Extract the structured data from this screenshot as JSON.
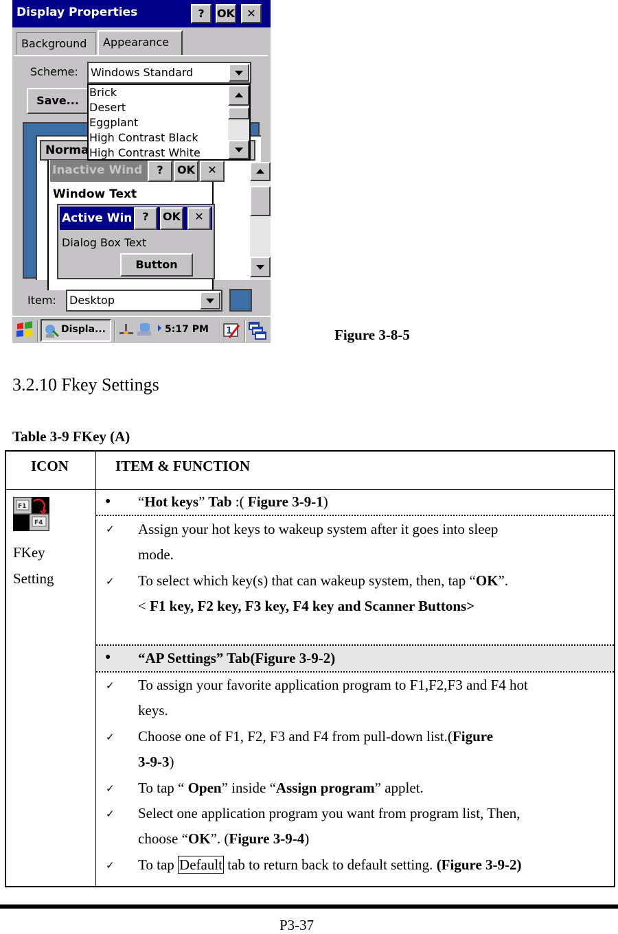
{
  "screenshot": {
    "window_title": "Display Properties",
    "title_buttons": {
      "help": "?",
      "ok": "OK",
      "close": "✕"
    },
    "tabs": [
      {
        "label": "Background",
        "active": false
      },
      {
        "label": "Appearance",
        "active": true
      }
    ],
    "scheme_label": "Scheme:",
    "scheme_value": "Windows Standard",
    "scheme_options": [
      "Brick",
      "Desert",
      "Eggplant",
      "High Contrast Black",
      "High Contrast White"
    ],
    "save_button": "Save...",
    "preview": {
      "normal_tab": "Normal",
      "inactive_title": "Inactive Wind",
      "window_text": "Window Text",
      "active_title": "Active Win",
      "dialog_text": "Dialog Box Text",
      "button_label": "Button",
      "btn_help": "?",
      "btn_ok": "OK",
      "btn_close": "✕"
    },
    "item_label": "Item:",
    "item_value": "Desktop",
    "item_color": "#3a6ea5",
    "taskbar": {
      "start_icon": "windows-flag-icon",
      "task_button": "Displa...",
      "time": "5:17 PM"
    },
    "colors": {
      "titlebar": "#00008b",
      "face": "#c6c3c6",
      "desktop": "#3a6ea5",
      "inactive": "#808080"
    }
  },
  "figure_caption": "Figure 3-8-5",
  "section_title": "3.2.10 Fkey Settings",
  "table_caption": "Table 3-9 FKey (A)",
  "table": {
    "headers": {
      "icon": "ICON",
      "item": "ITEM & FUNCTION"
    },
    "icon_label_line1": "FKey",
    "icon_label_line2": "Setting",
    "hotkeys_heading": {
      "q1": "“",
      "b1": "Hot keys",
      "q2": "”",
      "b2": " Tab",
      "mid": " :( ",
      "b3": "Figure 3-9-1",
      "end": ")"
    },
    "hotkeys_items": [
      {
        "line1": "Assign your hot keys to wakeup system after it goes into sleep",
        "line2": "mode."
      },
      {
        "pre": "To select which key(s) that can wakeup system, then, tap “",
        "bold": "OK",
        "post": "”.",
        "line2_pre": "< ",
        "line2_bold": "F1 key, F2 key, F3 key, F4 key and Scanner Buttons>"
      }
    ],
    "ap_heading": "“AP Settings” Tab(Figure 3-9-2)",
    "ap_items": [
      {
        "line1": "To assign your favorite application program to F1,F2,F3 and F4 hot",
        "line2": "keys."
      },
      {
        "pre": "Choose one of F1, F2, F3 and F4 from pull-down list.(",
        "bold": "Figure",
        "line2_bold": "3-9-3",
        "line2_post": ")"
      },
      {
        "pre": "To tap “ ",
        "b1": "Open",
        "mid": "” inside “",
        "b2": "Assign program",
        "post": "” applet."
      },
      {
        "line1": "Select one application program you want from program list, Then,",
        "line2_pre": "choose “",
        "line2_b1": "OK",
        "line2_mid": "”. (",
        "line2_b2": "Figure 3-9-4",
        "line2_post": ")"
      },
      {
        "pre": "To tap ",
        "boxed": "Default",
        "mid": " tab to return back to default setting. ",
        "bold": "(Figure 3-9-2)"
      }
    ]
  },
  "page_number": "P3-37"
}
